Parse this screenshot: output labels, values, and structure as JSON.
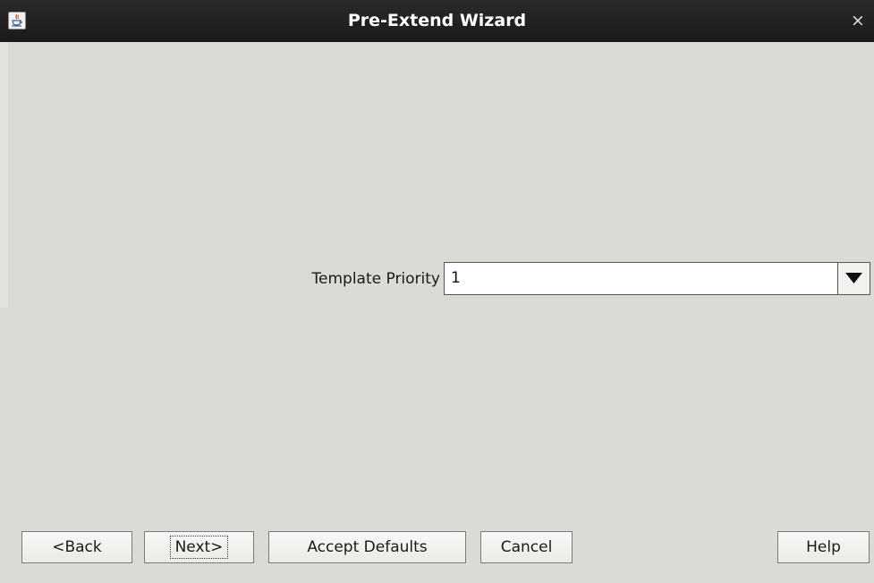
{
  "window": {
    "title": "Pre-Extend Wizard",
    "close_glyph": "×",
    "app_icon": "java-cup-icon"
  },
  "form": {
    "template_priority_label": "Template Priority",
    "template_priority_value": "1",
    "dropdown_icon": "triangle-down-icon"
  },
  "buttons": {
    "back": "<Back",
    "next": "Next>",
    "accept_defaults": "Accept Defaults",
    "cancel": "Cancel",
    "help": "Help"
  },
  "colors": {
    "titlebar": "#1f1f1f",
    "window_bg": "#dcdad5",
    "field_bg": "#ffffff"
  }
}
